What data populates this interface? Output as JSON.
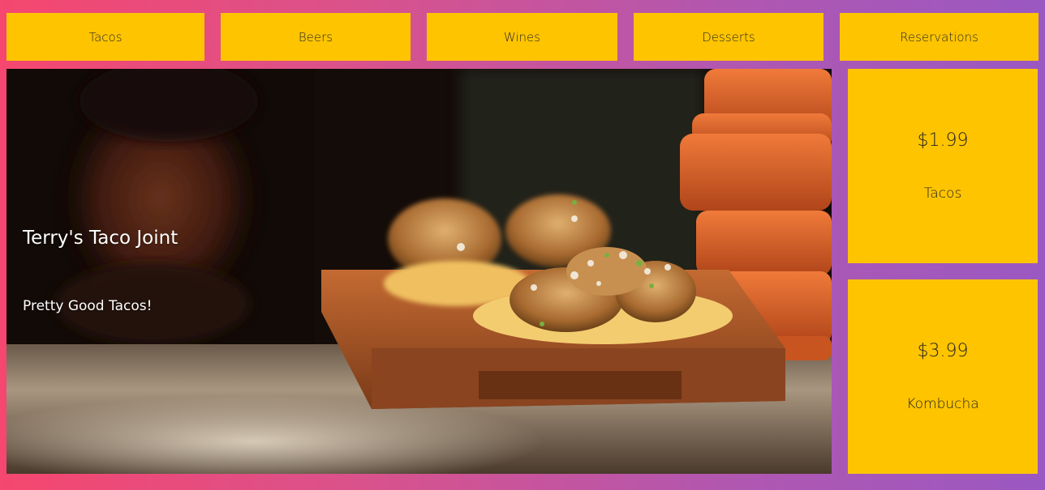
{
  "nav": {
    "items": [
      {
        "label": "Tacos"
      },
      {
        "label": "Beers"
      },
      {
        "label": "Wines"
      },
      {
        "label": "Desserts"
      },
      {
        "label": "Reservations"
      }
    ]
  },
  "hero": {
    "title": "Terry's Taco Joint",
    "subtitle": "Pretty Good Tacos!"
  },
  "cards": [
    {
      "price": "$1.99",
      "name": "Tacos"
    },
    {
      "price": "$3.99",
      "name": "Kombucha"
    }
  ],
  "colors": {
    "accent": "#ffc400",
    "gradient_start": "#f5476f",
    "gradient_end": "#9a58c2"
  }
}
